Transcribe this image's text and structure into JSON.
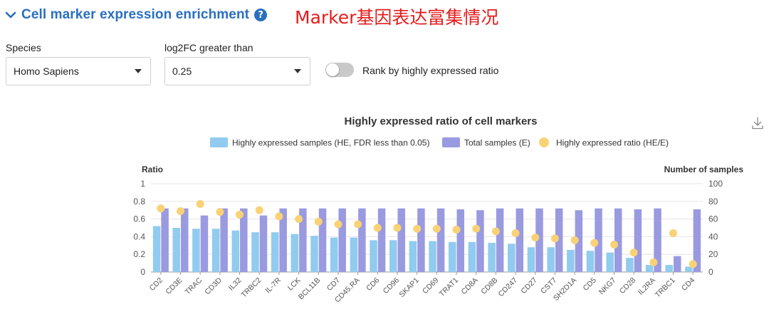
{
  "header": {
    "title": "Cell marker expression enrichment",
    "help_glyph": "?",
    "annotation": "Marker基因表达富集情况"
  },
  "filters": {
    "species_label": "Species",
    "species_value": "Homo Sapiens",
    "log2fc_label": "log2FC greater than",
    "log2fc_value": "0.25",
    "rank_toggle_label": "Rank by highly expressed ratio",
    "rank_toggle_on": false
  },
  "icons": [
    "chevron-down-icon",
    "help-icon",
    "caret-down-icon",
    "download-icon"
  ],
  "colors": {
    "title": "#2a6fbf",
    "annotation": "#e41c1c",
    "he_bar": "#91cbef",
    "total_bar": "#9a9ae0",
    "ratio_dot": "#f9d276"
  },
  "chart_data": {
    "type": "bar",
    "title": "Highly expressed ratio of cell markers",
    "left_axis_label": "Ratio",
    "right_axis_label": "Number of samples",
    "left_ylim": [
      0,
      1
    ],
    "left_ticks": [
      "0",
      "0.2",
      "0.4",
      "0.6",
      "0.8",
      "1"
    ],
    "right_ylim": [
      0,
      100
    ],
    "right_ticks": [
      "0",
      "20",
      "40",
      "60",
      "80",
      "100"
    ],
    "grid": true,
    "legend_position": "top-center",
    "legend": [
      "Highly expressed samples (HE, FDR less than 0.05)",
      "Total samples (E)",
      "Highly expressed ratio (HE/E)"
    ],
    "categories": [
      "CD2",
      "CD3E",
      "TRAC",
      "CD3D",
      "IL32",
      "TRBC2",
      "IL-7R",
      "LCK",
      "BCL11B",
      "CD7",
      "CD45.RA",
      "CD6",
      "CD96",
      "SKAP1",
      "CD69",
      "TRAT1",
      "CD8A",
      "CD8B",
      "CD247",
      "CD27",
      "CST7",
      "SH2D1A",
      "CD5",
      "NKG7",
      "CD28",
      "IL2RA",
      "TRBC1",
      "CD4"
    ],
    "series": [
      {
        "name": "Highly expressed samples (HE, FDR less than 0.05)",
        "axis": "right",
        "values": [
          52,
          50,
          49,
          49,
          47,
          45,
          45,
          43,
          41,
          39,
          39,
          36,
          36,
          35,
          35,
          34,
          34,
          33,
          32,
          28,
          28,
          25,
          24,
          22,
          16,
          8,
          8,
          6
        ]
      },
      {
        "name": "Total samples (E)",
        "axis": "right",
        "values": [
          72,
          72,
          64,
          72,
          72,
          64,
          72,
          72,
          72,
          72,
          72,
          72,
          72,
          72,
          72,
          71,
          70,
          72,
          72,
          72,
          72,
          70,
          72,
          72,
          71,
          72,
          18,
          71
        ]
      },
      {
        "name": "Highly expressed ratio (HE/E)",
        "axis": "left",
        "values": [
          0.72,
          0.69,
          0.77,
          0.68,
          0.65,
          0.7,
          0.63,
          0.6,
          0.57,
          0.54,
          0.54,
          0.5,
          0.5,
          0.49,
          0.49,
          0.48,
          0.49,
          0.46,
          0.44,
          0.39,
          0.38,
          0.36,
          0.33,
          0.31,
          0.22,
          0.11,
          0.44,
          0.09
        ]
      }
    ]
  }
}
